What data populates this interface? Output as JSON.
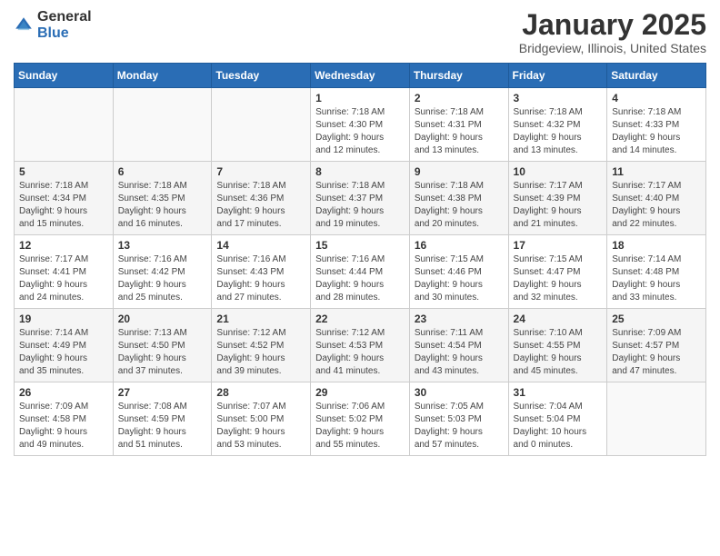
{
  "header": {
    "logo_general": "General",
    "logo_blue": "Blue",
    "title": "January 2025",
    "location": "Bridgeview, Illinois, United States"
  },
  "calendar": {
    "weekdays": [
      "Sunday",
      "Monday",
      "Tuesday",
      "Wednesday",
      "Thursday",
      "Friday",
      "Saturday"
    ],
    "rows": [
      {
        "shade": false,
        "days": [
          {
            "num": "",
            "info": ""
          },
          {
            "num": "",
            "info": ""
          },
          {
            "num": "",
            "info": ""
          },
          {
            "num": "1",
            "info": "Sunrise: 7:18 AM\nSunset: 4:30 PM\nDaylight: 9 hours\nand 12 minutes."
          },
          {
            "num": "2",
            "info": "Sunrise: 7:18 AM\nSunset: 4:31 PM\nDaylight: 9 hours\nand 13 minutes."
          },
          {
            "num": "3",
            "info": "Sunrise: 7:18 AM\nSunset: 4:32 PM\nDaylight: 9 hours\nand 13 minutes."
          },
          {
            "num": "4",
            "info": "Sunrise: 7:18 AM\nSunset: 4:33 PM\nDaylight: 9 hours\nand 14 minutes."
          }
        ]
      },
      {
        "shade": true,
        "days": [
          {
            "num": "5",
            "info": "Sunrise: 7:18 AM\nSunset: 4:34 PM\nDaylight: 9 hours\nand 15 minutes."
          },
          {
            "num": "6",
            "info": "Sunrise: 7:18 AM\nSunset: 4:35 PM\nDaylight: 9 hours\nand 16 minutes."
          },
          {
            "num": "7",
            "info": "Sunrise: 7:18 AM\nSunset: 4:36 PM\nDaylight: 9 hours\nand 17 minutes."
          },
          {
            "num": "8",
            "info": "Sunrise: 7:18 AM\nSunset: 4:37 PM\nDaylight: 9 hours\nand 19 minutes."
          },
          {
            "num": "9",
            "info": "Sunrise: 7:18 AM\nSunset: 4:38 PM\nDaylight: 9 hours\nand 20 minutes."
          },
          {
            "num": "10",
            "info": "Sunrise: 7:17 AM\nSunset: 4:39 PM\nDaylight: 9 hours\nand 21 minutes."
          },
          {
            "num": "11",
            "info": "Sunrise: 7:17 AM\nSunset: 4:40 PM\nDaylight: 9 hours\nand 22 minutes."
          }
        ]
      },
      {
        "shade": false,
        "days": [
          {
            "num": "12",
            "info": "Sunrise: 7:17 AM\nSunset: 4:41 PM\nDaylight: 9 hours\nand 24 minutes."
          },
          {
            "num": "13",
            "info": "Sunrise: 7:16 AM\nSunset: 4:42 PM\nDaylight: 9 hours\nand 25 minutes."
          },
          {
            "num": "14",
            "info": "Sunrise: 7:16 AM\nSunset: 4:43 PM\nDaylight: 9 hours\nand 27 minutes."
          },
          {
            "num": "15",
            "info": "Sunrise: 7:16 AM\nSunset: 4:44 PM\nDaylight: 9 hours\nand 28 minutes."
          },
          {
            "num": "16",
            "info": "Sunrise: 7:15 AM\nSunset: 4:46 PM\nDaylight: 9 hours\nand 30 minutes."
          },
          {
            "num": "17",
            "info": "Sunrise: 7:15 AM\nSunset: 4:47 PM\nDaylight: 9 hours\nand 32 minutes."
          },
          {
            "num": "18",
            "info": "Sunrise: 7:14 AM\nSunset: 4:48 PM\nDaylight: 9 hours\nand 33 minutes."
          }
        ]
      },
      {
        "shade": true,
        "days": [
          {
            "num": "19",
            "info": "Sunrise: 7:14 AM\nSunset: 4:49 PM\nDaylight: 9 hours\nand 35 minutes."
          },
          {
            "num": "20",
            "info": "Sunrise: 7:13 AM\nSunset: 4:50 PM\nDaylight: 9 hours\nand 37 minutes."
          },
          {
            "num": "21",
            "info": "Sunrise: 7:12 AM\nSunset: 4:52 PM\nDaylight: 9 hours\nand 39 minutes."
          },
          {
            "num": "22",
            "info": "Sunrise: 7:12 AM\nSunset: 4:53 PM\nDaylight: 9 hours\nand 41 minutes."
          },
          {
            "num": "23",
            "info": "Sunrise: 7:11 AM\nSunset: 4:54 PM\nDaylight: 9 hours\nand 43 minutes."
          },
          {
            "num": "24",
            "info": "Sunrise: 7:10 AM\nSunset: 4:55 PM\nDaylight: 9 hours\nand 45 minutes."
          },
          {
            "num": "25",
            "info": "Sunrise: 7:09 AM\nSunset: 4:57 PM\nDaylight: 9 hours\nand 47 minutes."
          }
        ]
      },
      {
        "shade": false,
        "days": [
          {
            "num": "26",
            "info": "Sunrise: 7:09 AM\nSunset: 4:58 PM\nDaylight: 9 hours\nand 49 minutes."
          },
          {
            "num": "27",
            "info": "Sunrise: 7:08 AM\nSunset: 4:59 PM\nDaylight: 9 hours\nand 51 minutes."
          },
          {
            "num": "28",
            "info": "Sunrise: 7:07 AM\nSunset: 5:00 PM\nDaylight: 9 hours\nand 53 minutes."
          },
          {
            "num": "29",
            "info": "Sunrise: 7:06 AM\nSunset: 5:02 PM\nDaylight: 9 hours\nand 55 minutes."
          },
          {
            "num": "30",
            "info": "Sunrise: 7:05 AM\nSunset: 5:03 PM\nDaylight: 9 hours\nand 57 minutes."
          },
          {
            "num": "31",
            "info": "Sunrise: 7:04 AM\nSunset: 5:04 PM\nDaylight: 10 hours\nand 0 minutes."
          },
          {
            "num": "",
            "info": ""
          }
        ]
      }
    ]
  }
}
